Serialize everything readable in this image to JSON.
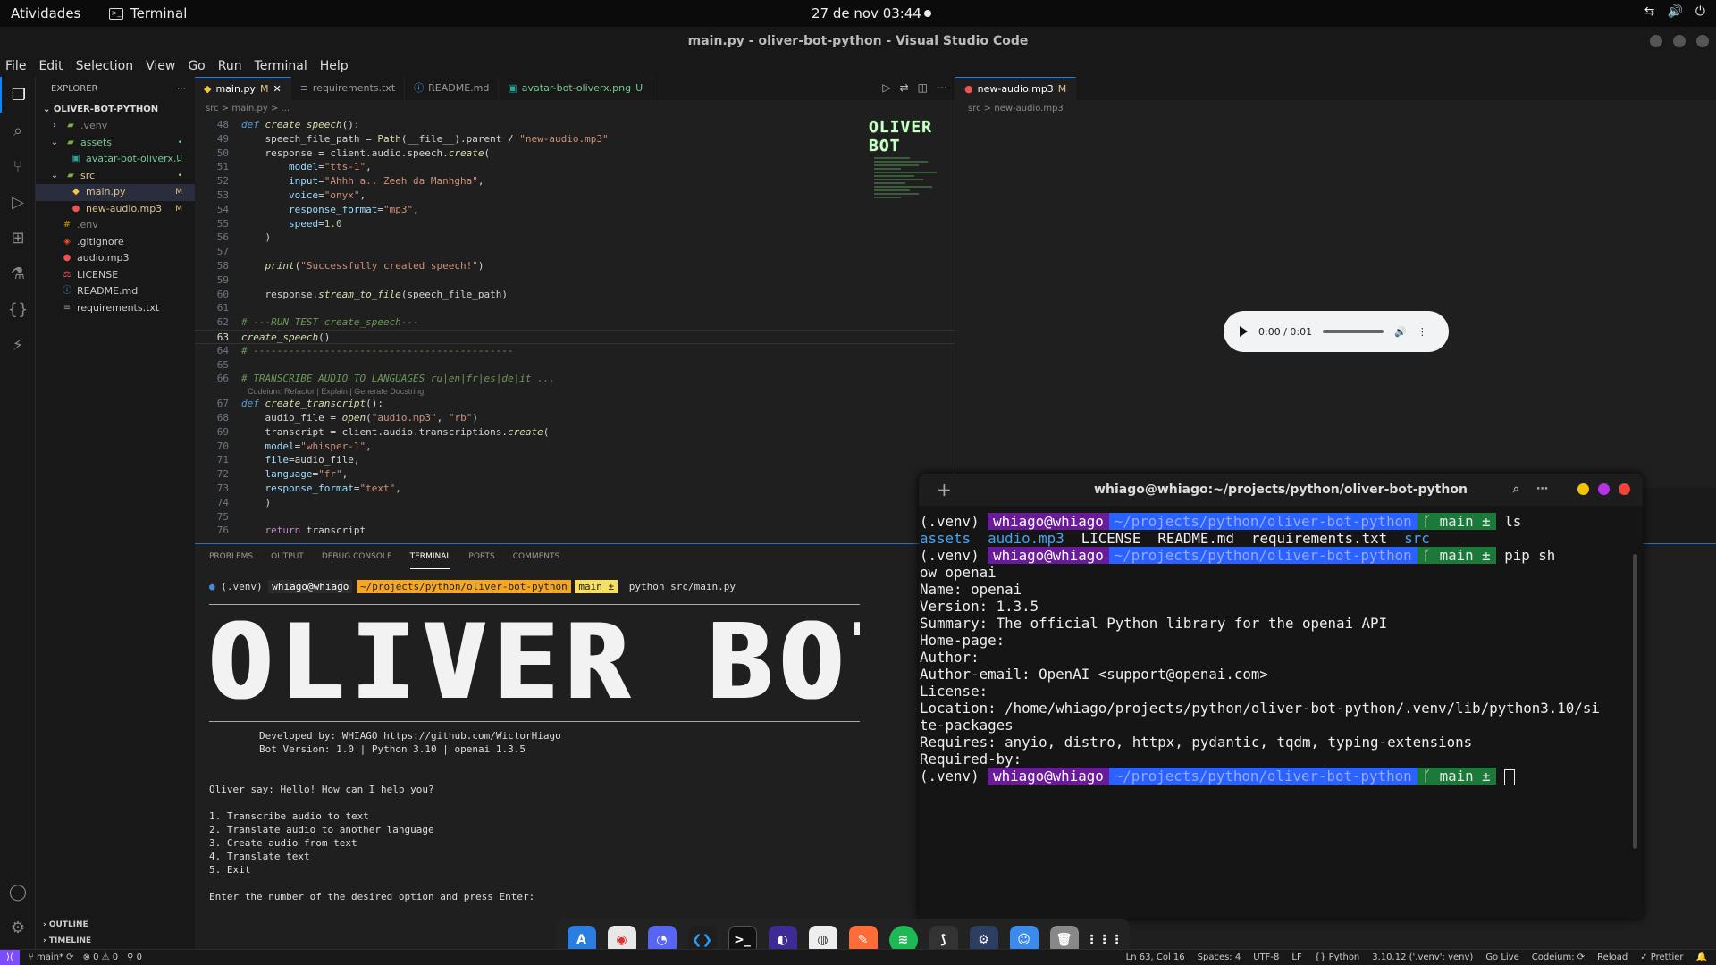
{
  "topbar": {
    "activities": "Atividades",
    "app_name": "Terminal",
    "clock": "27 de nov  03:44",
    "tray": [
      "⇆",
      "🔊",
      "⏻"
    ]
  },
  "window": {
    "title": "main.py - oliver-bot-python - Visual Studio Code"
  },
  "menu": [
    "File",
    "Edit",
    "Selection",
    "View",
    "Go",
    "Run",
    "Terminal",
    "Help"
  ],
  "explorer": {
    "title": "EXPLORER",
    "project": "OLIVER-BOT-PYTHON",
    "items": [
      {
        "label": ".venv",
        "badge": ""
      },
      {
        "label": "assets",
        "badge": "•"
      },
      {
        "label": "avatar-bot-oliverx...",
        "badge": "U"
      },
      {
        "label": "src",
        "badge": "•"
      },
      {
        "label": "main.py",
        "badge": "M"
      },
      {
        "label": "new-audio.mp3",
        "badge": "M"
      },
      {
        "label": ".env",
        "badge": ""
      },
      {
        "label": ".gitignore",
        "badge": ""
      },
      {
        "label": "audio.mp3",
        "badge": ""
      },
      {
        "label": "LICENSE",
        "badge": ""
      },
      {
        "label": "README.md",
        "badge": ""
      },
      {
        "label": "requirements.txt",
        "badge": ""
      }
    ],
    "outline": "OUTLINE",
    "timeline": "TIMELINE"
  },
  "tabs": [
    {
      "label": "main.py",
      "flag": "M"
    },
    {
      "label": "requirements.txt",
      "flag": ""
    },
    {
      "label": "README.md",
      "flag": ""
    },
    {
      "label": "avatar-bot-oliverx.png",
      "flag": "U"
    }
  ],
  "breadcrumb": "src  >  main.py  > ...",
  "codelens": "Codeium: Refactor | Explain | Generate Docstring",
  "minimap_logo": "OLIVER BOT",
  "right_pane": {
    "tab": "new-audio.mp3",
    "flag": "M",
    "crumb": "src  >  new-audio.mp3",
    "player_time": "0:00 / 0:01"
  },
  "panel": {
    "tabs": [
      "PROBLEMS",
      "OUTPUT",
      "DEBUG CONSOLE",
      "TERMINAL",
      "PORTS",
      "COMMENTS"
    ],
    "prompt_venv": "(.venv)",
    "prompt_user": "whiago@whiago",
    "prompt_path": "~/projects/python/oliver-bot-python",
    "prompt_branch": "main ±",
    "command": "python src/main.py",
    "banner": "OLIVER BOT",
    "dev_line": "Developed by: WHIAGO https://github.com/WictorHiago",
    "ver_line": "Bot Version: 1.0 | Python 3.10 | openai 1.3.5",
    "greeting": "Oliver say: Hello! How can I help you?",
    "options": [
      "1. Transcribe audio to text",
      "2. Translate audio to another language",
      "3. Create audio from text",
      "4. Translate text",
      "5. Exit"
    ],
    "input_prompt": "Enter the number of the desired option and press Enter:"
  },
  "gterm": {
    "title": "whiago@whiago:~/projects/python/oliver-bot-python",
    "venv": "(.venv)",
    "user": "whiago@whiago",
    "path": "~/projects/python/oliver-bot-python",
    "branch": "main ±",
    "cmd1": "ls",
    "ls_dirs": [
      "assets",
      "audio.mp3"
    ],
    "ls_files": [
      "LICENSE",
      "README.md",
      "requirements.txt"
    ],
    "ls_src": "src",
    "cmd2a": "pip sh",
    "cmd2b": "ow openai",
    "output": [
      "Name: openai",
      "Version: 1.3.5",
      "Summary: The official Python library for the openai API",
      "Home-page:",
      "Author:",
      "Author-email: OpenAI <support@openai.com>",
      "License:",
      "Location: /home/whiago/projects/python/oliver-bot-python/.venv/lib/python3.10/si",
      "te-packages",
      "Requires: anyio, distro, httpx, pydantic, tqdm, typing-extensions",
      "Required-by:"
    ]
  },
  "status": {
    "branch": "main*",
    "errors": "⊗ 0 ⚠ 0",
    "ports": "⚲ 0",
    "right": [
      "Ln 63, Col 16",
      "Spaces: 4",
      "UTF-8",
      "LF",
      "{} Python",
      "3.10.12 ('.venv': venv)",
      "Go Live",
      "Codeium: ⟳",
      "Reload",
      "✓ Prettier",
      "🔔"
    ]
  },
  "colors": {
    "accent": "#0a84ff",
    "gterm_user": "#6a1b9a",
    "gterm_path": "#2962ff",
    "gterm_branch": "#1b7a3a"
  }
}
